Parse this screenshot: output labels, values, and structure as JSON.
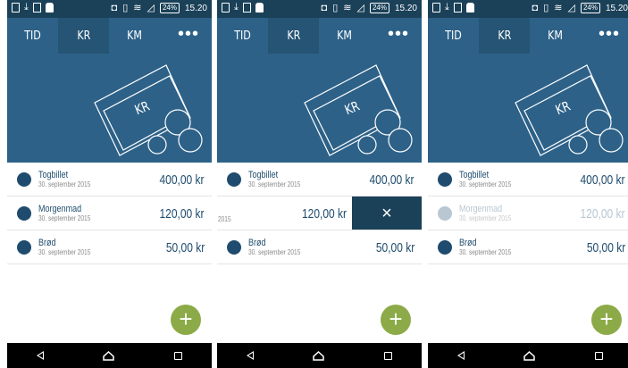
{
  "status_bar": {
    "battery": "24%",
    "time": "15.20"
  },
  "tabs": [
    "TID",
    "KR",
    "KM"
  ],
  "active_tab": "KR",
  "menu_icon": "more-dots-icon",
  "hero": {
    "label": "KR",
    "icon": "money-bills-coins-illustration"
  },
  "expenses": [
    {
      "name": "Togbillet",
      "date": "30. september 2015",
      "amount": "400,00 kr"
    },
    {
      "name": "Morgenmad",
      "date": "30. september 2015",
      "amount": "120,00 kr"
    },
    {
      "name": "Brød",
      "date": "30. september 2015",
      "amount": "50,00 kr"
    }
  ],
  "swiped_row": {
    "date_fragment": "2015",
    "amount": "120,00 kr",
    "delete_icon": "×"
  },
  "fab": {
    "label": "+"
  },
  "colors": {
    "header": "#2d6188",
    "status_bar": "#1b4159",
    "accent_green": "#8cab48",
    "text_primary": "#1f4c6e"
  }
}
